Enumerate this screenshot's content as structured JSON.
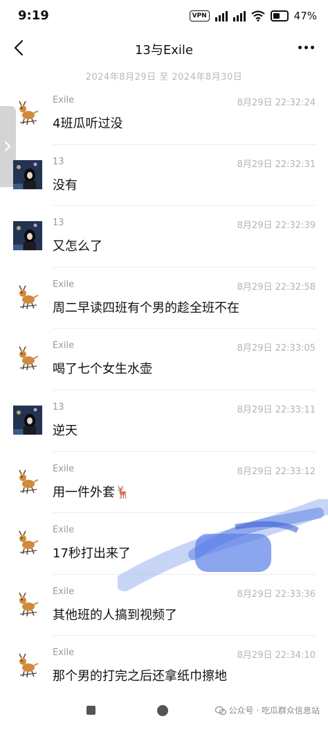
{
  "status_bar": {
    "time": "9:19",
    "vpn": "VPN",
    "battery_pct": "47%"
  },
  "header": {
    "title": "13与Exile"
  },
  "date_range": "2024年8月29日 至 2024年8月30日",
  "messages": [
    {
      "sender": "Exile",
      "time": "8月29日 22:32:24",
      "text": "4班瓜听过没",
      "avatar": "deer-figure"
    },
    {
      "sender": "13",
      "time": "8月29日 22:32:31",
      "text": "没有",
      "avatar": "dark-photo"
    },
    {
      "sender": "13",
      "time": "8月29日 22:32:39",
      "text": "又怎么了",
      "avatar": "dark-photo"
    },
    {
      "sender": "Exile",
      "time": "8月29日 22:32:58",
      "text": "周二早读四班有个男的趁全班不在",
      "avatar": "deer-figure"
    },
    {
      "sender": "Exile",
      "time": "8月29日 22:33:05",
      "text": "喝了七个女生水壶",
      "avatar": "deer-figure"
    },
    {
      "sender": "13",
      "time": "8月29日 22:33:11",
      "text": "逆天",
      "avatar": "dark-photo"
    },
    {
      "sender": "Exile",
      "time": "8月29日 22:33:12",
      "text": "用一件外套🦌",
      "avatar": "deer-figure"
    },
    {
      "sender": "Exile",
      "time": "",
      "text": "17秒打出来了",
      "avatar": "deer-figure"
    },
    {
      "sender": "Exile",
      "time": "8月29日 22:33:36",
      "text": "其他班的人搞到视频了",
      "avatar": "deer-figure"
    },
    {
      "sender": "Exile",
      "time": "8月29日 22:34:10",
      "text": "那个男的打完之后还拿纸巾擦地",
      "avatar": "deer-figure"
    }
  ],
  "watermark": "公众号 · 吃瓜群众信息站",
  "colors": {
    "accent_scribble": "#5a7fe8",
    "meta_text": "#b4b4b4"
  }
}
